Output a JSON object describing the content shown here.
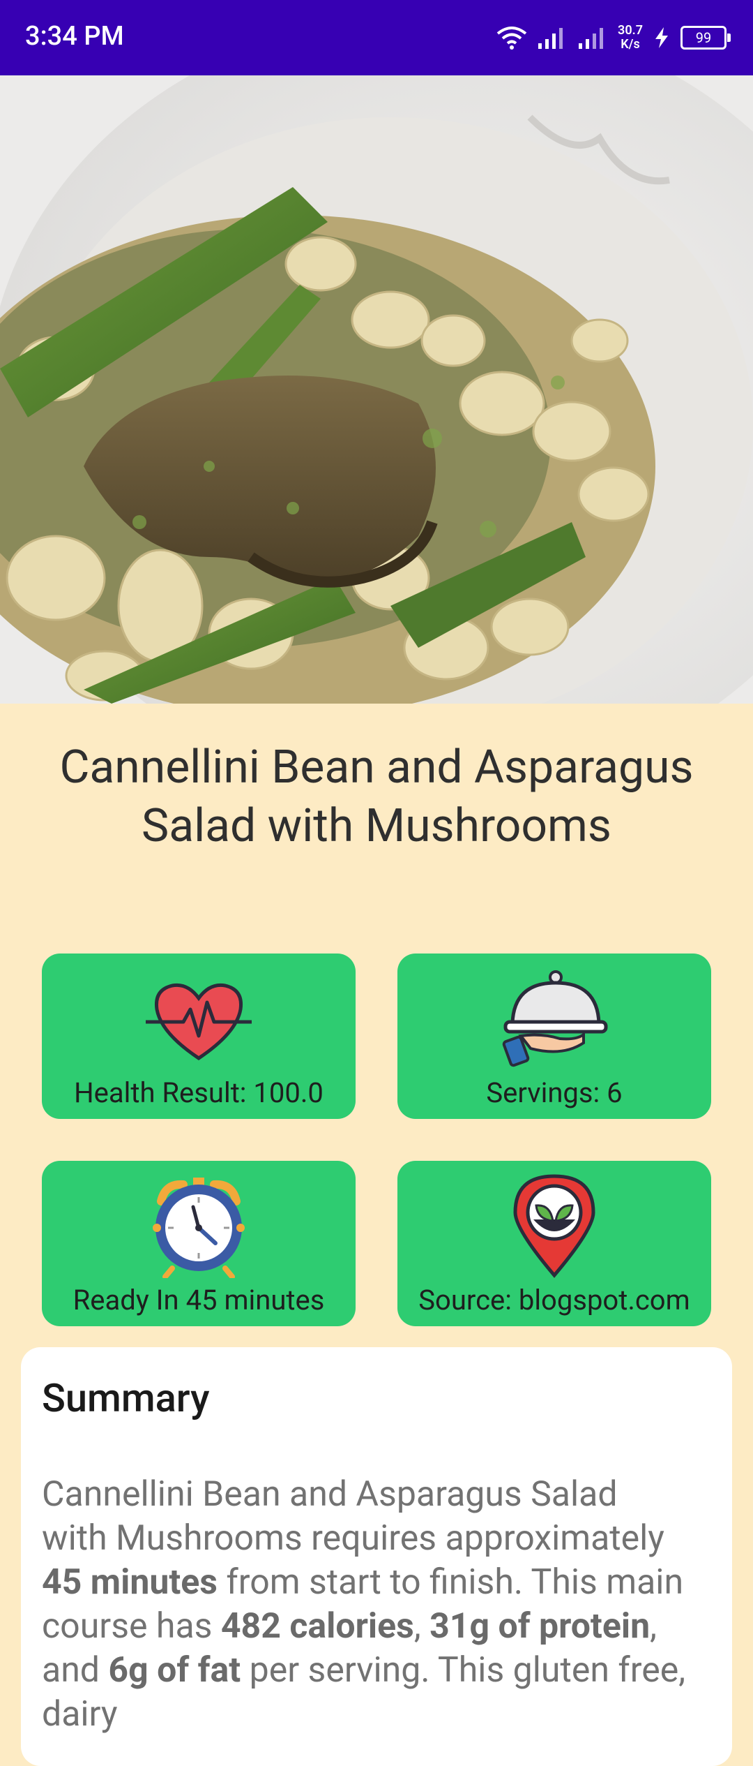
{
  "status_bar": {
    "time": "3:34 PM",
    "net_speed_value": "30.7",
    "net_speed_unit": "K/s",
    "battery": "99"
  },
  "recipe": {
    "title": "Cannellini Bean and Asparagus Salad with Mushrooms",
    "image_alt": "cannellini bean, asparagus and mushroom salad on a white plate"
  },
  "cards": [
    {
      "icon": "heart-pulse-icon",
      "label": "Health Result: 100.0"
    },
    {
      "icon": "serving-dish-icon",
      "label": "Servings: 6"
    },
    {
      "icon": "alarm-clock-icon",
      "label": "Ready In 45 minutes"
    },
    {
      "icon": "location-pin-icon",
      "label": "Source: blogspot.com"
    }
  ],
  "summary": {
    "title": "Summary",
    "t1": "Cannellini Bean and Asparagus Salad with Mushrooms requires approximately ",
    "b1": "45 minutes",
    "t2": " from start to finish. This main course has ",
    "b2": "482 calories",
    "t3": ", ",
    "b3": "31g of protein",
    "t4": ", and ",
    "b4": "6g of fat",
    "t5": " per serving. This gluten free, dairy"
  },
  "colors": {
    "status_bar": "#3700B3",
    "background": "#FDEBC4",
    "card": "#2ECC71",
    "summary_bg": "#FFFFFF"
  }
}
